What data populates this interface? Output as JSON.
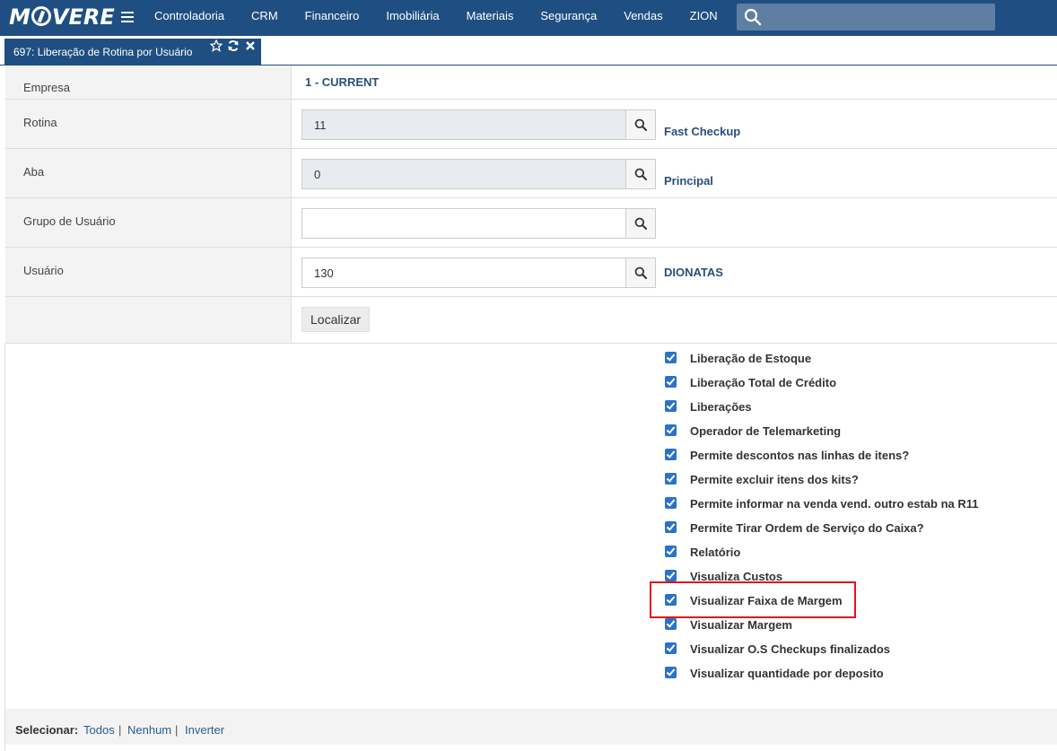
{
  "brand": {
    "logo_pre": "M",
    "logo_post": "VERE"
  },
  "menu": [
    "Controladoria",
    "CRM",
    "Financeiro",
    "Imobiliária",
    "Materiais",
    "Segurança",
    "Vendas",
    "ZION"
  ],
  "search": {
    "placeholder": ""
  },
  "tab": {
    "title": "697: Liberação de Rotina por Usuário"
  },
  "form": {
    "empresa": {
      "label": "Empresa",
      "value": "1 - CURRENT"
    },
    "rotina": {
      "label": "Rotina",
      "value": "11",
      "desc": "Fast Checkup"
    },
    "aba": {
      "label": "Aba",
      "value": "0",
      "desc": "Principal"
    },
    "grupo": {
      "label": "Grupo de Usuário",
      "value": "",
      "desc": ""
    },
    "usuario": {
      "label": "Usuário",
      "value": "130",
      "desc": "DIONATAS"
    },
    "localizar": "Localizar"
  },
  "checks": [
    "Liberação de Estoque",
    "Liberação Total de Crédito",
    "Liberações",
    "Operador de Telemarketing",
    "Permite descontos nas linhas de itens?",
    "Permite excluir itens dos kits?",
    "Permite informar na venda vend. outro estab na R11",
    "Permite Tirar Ordem de Serviço do Caixa?",
    "Relatório",
    "Visualiza Custos",
    "Visualizar Faixa de Margem",
    "Visualizar Margem",
    "Visualizar O.S Checkups finalizados",
    "Visualizar quantidade por deposito"
  ],
  "footer": {
    "select_label": "Selecionar:",
    "all": "Todos",
    "none": "Nenhum",
    "invert": "Inverter",
    "sep": "|"
  },
  "colors": {
    "navbar": "#1f4f82",
    "link": "#2a5c93",
    "checkbox": "#2a73c7",
    "highlight": "#e0141e"
  }
}
